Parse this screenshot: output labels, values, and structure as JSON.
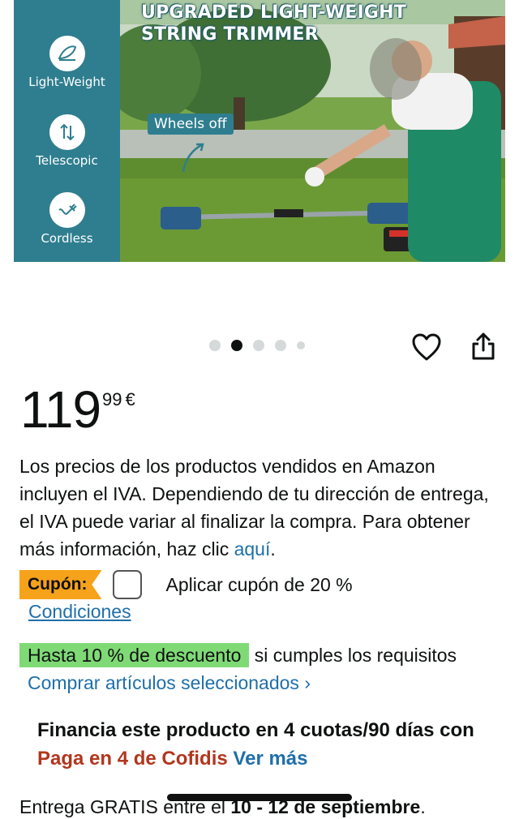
{
  "hero": {
    "title_line1": "UPGRADED LIGHT-WEIGHT",
    "title_line2": "STRING TRIMMER",
    "wheels_tag": "Wheels off",
    "features": [
      {
        "label": "Light-Weight",
        "icon": "feather-icon"
      },
      {
        "label": "Telescopic",
        "icon": "telescopic-arrows-icon"
      },
      {
        "label": "Cordless",
        "icon": "plug-icon"
      }
    ]
  },
  "carousel": {
    "count": 5,
    "active_index": 1
  },
  "price": {
    "whole": "119",
    "fraction": "99",
    "currency": "€"
  },
  "vat_notice": {
    "text": "Los precios de los productos vendidos en Amazon incluyen el IVA. Dependiendo de tu dirección de entrega, el IVA puede variar al finalizar la compra. Para obtener más información, haz clic ",
    "link": "aquí",
    "end": "."
  },
  "coupon": {
    "badge": "Cupón:",
    "text": "Aplicar cupón de 20 %",
    "conditions": "Condiciones",
    "checked": false
  },
  "discount": {
    "badge": "Hasta 10 % de descuento",
    "text": " si cumples los requisitos",
    "link": "Comprar artículos seleccionados ›"
  },
  "financing": {
    "text": "Financia este producto en 4 cuotas/90 días con ",
    "brand": "Paga en 4 de Cofidis",
    "link": "Ver más"
  },
  "delivery": {
    "prefix": "Entrega GRATIS entre el ",
    "dates": "10 - 12 de septiembre",
    "suffix": "."
  },
  "colors": {
    "coupon_badge": "#f7a21b",
    "discount_badge": "#7fda76",
    "link": "#1f6fa9",
    "cofidis": "#b1361e",
    "hero_panel": "#2f7e8f"
  }
}
